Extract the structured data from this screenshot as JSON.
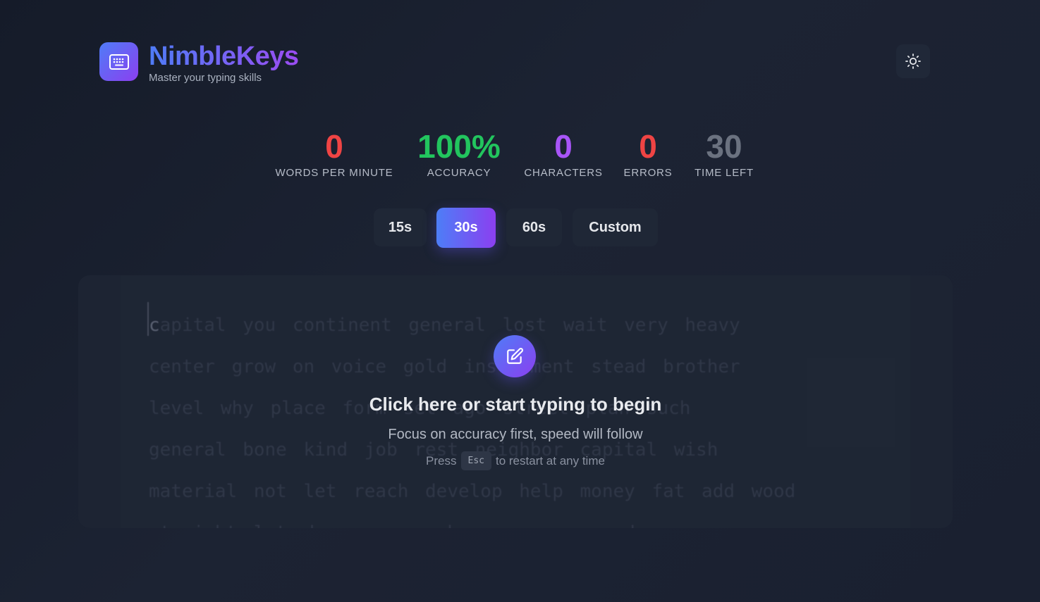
{
  "header": {
    "app_name": "NimbleKeys",
    "tagline": "Master your typing skills",
    "logo_icon": "keyboard-icon",
    "theme_toggle_icon": "sun-icon"
  },
  "stats": [
    {
      "name": "wpm",
      "value": "0",
      "label": "WORDS PER MINUTE",
      "color": "#ef4444"
    },
    {
      "name": "accuracy",
      "value": "100%",
      "label": "ACCURACY",
      "color": "#22c55e"
    },
    {
      "name": "characters",
      "value": "0",
      "label": "CHARACTERS",
      "color": "#a855f7"
    },
    {
      "name": "errors",
      "value": "0",
      "label": "ERRORS",
      "color": "#ef4444"
    },
    {
      "name": "time-left",
      "value": "30",
      "label": "TIME LEFT",
      "color": "#6b7280"
    }
  ],
  "modes": [
    {
      "label": "15s",
      "active": false
    },
    {
      "label": "30s",
      "active": true
    },
    {
      "label": "60s",
      "active": false
    },
    {
      "label": "Custom",
      "active": false
    }
  ],
  "typing": {
    "first_char": "c",
    "first_rest": "apital",
    "lines": [
      "you continent general lost wait very heavy",
      "center grow on voice gold instrument stead brother",
      "level why place form set ago street plan such",
      "general bone kind job rest neighbor capital wish",
      "material not let reach develop help money fat add wood",
      "straight lot done oxygen began carry send"
    ]
  },
  "prompt": {
    "icon": "edit-icon",
    "title": "Click here or start typing to begin",
    "subtitle": "Focus on accuracy first, speed will follow",
    "hint_before": "Press",
    "hint_key": "Esc",
    "hint_after": "to restart at any time"
  },
  "colors": {
    "accent_start": "#4f7cf7",
    "accent_end": "#8b3ff0",
    "background": "#1a2030"
  }
}
